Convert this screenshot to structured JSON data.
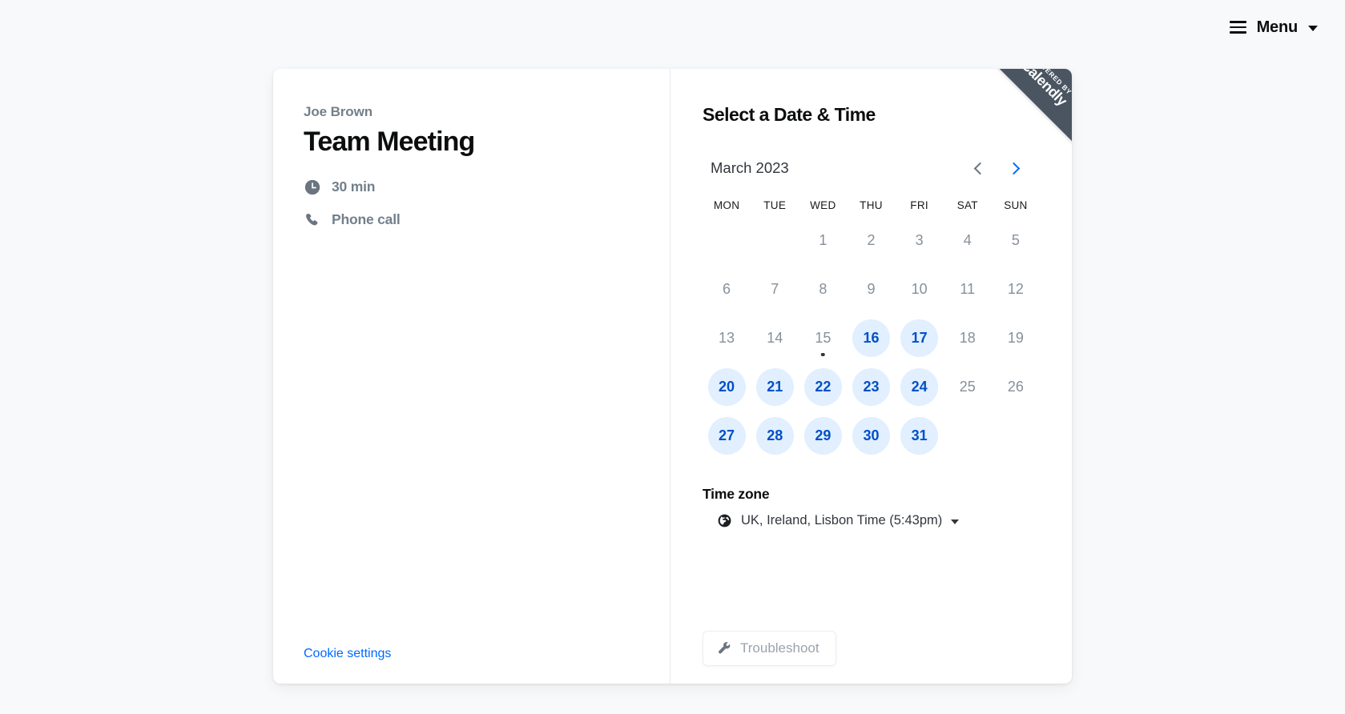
{
  "header": {
    "menu_label": "Menu",
    "hamburger_icon": "hamburger-icon",
    "caret_icon": "chevron-down-icon"
  },
  "ribbon": {
    "powered_by": "POWERED BY",
    "brand": "Calendly",
    "bg_color": "#4a5561"
  },
  "event": {
    "host": "Joe Brown",
    "title": "Team Meeting",
    "duration": "30 min",
    "duration_icon": "clock-icon",
    "location": "Phone call",
    "location_icon": "phone-icon",
    "cookie_settings": "Cookie settings",
    "link_color": "#0069ff"
  },
  "scheduler": {
    "heading": "Select a Date & Time",
    "month_label": "March 2023",
    "prev_icon": "chevron-left-icon",
    "next_icon": "chevron-right-icon",
    "prev_enabled": false,
    "next_enabled": true,
    "weekdays": [
      "MON",
      "TUE",
      "WED",
      "THU",
      "FRI",
      "SAT",
      "SUN"
    ],
    "accent_color": "#0069ff",
    "available_bg": "#e1effe",
    "available_text": "#0050c7",
    "disabled_text": "#86909a",
    "weeks": [
      [
        {
          "label": "",
          "state": "empty"
        },
        {
          "label": "",
          "state": "empty"
        },
        {
          "label": "1",
          "state": "disabled"
        },
        {
          "label": "2",
          "state": "disabled"
        },
        {
          "label": "3",
          "state": "disabled"
        },
        {
          "label": "4",
          "state": "disabled"
        },
        {
          "label": "5",
          "state": "disabled"
        }
      ],
      [
        {
          "label": "6",
          "state": "disabled"
        },
        {
          "label": "7",
          "state": "disabled"
        },
        {
          "label": "8",
          "state": "disabled"
        },
        {
          "label": "9",
          "state": "disabled"
        },
        {
          "label": "10",
          "state": "disabled"
        },
        {
          "label": "11",
          "state": "disabled"
        },
        {
          "label": "12",
          "state": "disabled"
        }
      ],
      [
        {
          "label": "13",
          "state": "disabled"
        },
        {
          "label": "14",
          "state": "disabled"
        },
        {
          "label": "15",
          "state": "disabled",
          "today": true
        },
        {
          "label": "16",
          "state": "available"
        },
        {
          "label": "17",
          "state": "available"
        },
        {
          "label": "18",
          "state": "disabled"
        },
        {
          "label": "19",
          "state": "disabled"
        }
      ],
      [
        {
          "label": "20",
          "state": "available"
        },
        {
          "label": "21",
          "state": "available"
        },
        {
          "label": "22",
          "state": "available"
        },
        {
          "label": "23",
          "state": "available"
        },
        {
          "label": "24",
          "state": "available"
        },
        {
          "label": "25",
          "state": "disabled"
        },
        {
          "label": "26",
          "state": "disabled"
        }
      ],
      [
        {
          "label": "27",
          "state": "available"
        },
        {
          "label": "28",
          "state": "available"
        },
        {
          "label": "29",
          "state": "available"
        },
        {
          "label": "30",
          "state": "available"
        },
        {
          "label": "31",
          "state": "available"
        },
        {
          "label": "",
          "state": "empty"
        },
        {
          "label": "",
          "state": "empty"
        }
      ]
    ],
    "timezone": {
      "title": "Time zone",
      "value": "UK, Ireland, Lisbon Time (5:43pm)",
      "globe_icon": "globe-icon",
      "caret_icon": "chevron-down-icon"
    },
    "troubleshoot": {
      "label": "Troubleshoot",
      "icon": "wrench-icon"
    }
  }
}
